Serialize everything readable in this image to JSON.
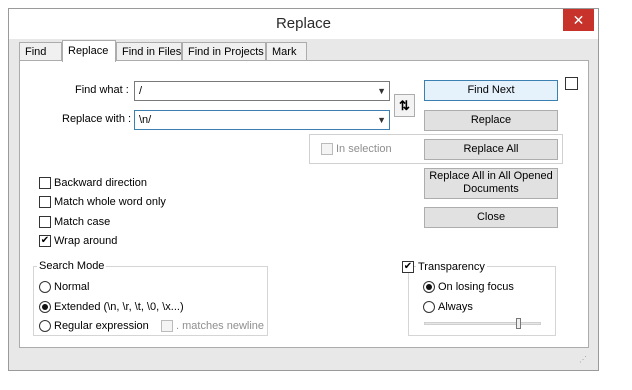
{
  "window": {
    "title": "Replace",
    "close_glyph": "✕"
  },
  "tabs": [
    {
      "label": "Find",
      "active": false
    },
    {
      "label": "Replace",
      "active": true
    },
    {
      "label": "Find in Files",
      "active": false
    },
    {
      "label": "Find in Projects",
      "active": false
    },
    {
      "label": "Mark",
      "active": false
    }
  ],
  "find": {
    "label": "Find what :",
    "value": "/"
  },
  "replace": {
    "label": "Replace with :",
    "value": "\\n/"
  },
  "swap_glyph": "⇅",
  "buttons": {
    "find_next": "Find Next",
    "replace": "Replace",
    "replace_all": "Replace All",
    "replace_all_opened_line1": "Replace All in All Opened",
    "replace_all_opened_line2": "Documents",
    "close": "Close"
  },
  "in_selection": {
    "label": "In selection",
    "checked": false,
    "enabled": false
  },
  "options": {
    "backward": {
      "label": "Backward direction",
      "checked": false
    },
    "whole_word": {
      "label": "Match whole word only",
      "checked": false
    },
    "match_case": {
      "label": "Match case",
      "checked": false
    },
    "wrap_around": {
      "label": "Wrap around",
      "checked": true
    }
  },
  "search_mode": {
    "title": "Search Mode",
    "normal": "Normal",
    "extended": "Extended (\\n, \\r, \\t, \\0, \\x...)",
    "regex": "Regular expression",
    "matches_newline": ". matches newline",
    "selected": "extended"
  },
  "transparency": {
    "label": "Transparency",
    "checked": true,
    "on_losing_focus": "On losing focus",
    "always": "Always",
    "selected": "on_losing_focus",
    "level": 0.8
  },
  "check_glyph": "✔"
}
